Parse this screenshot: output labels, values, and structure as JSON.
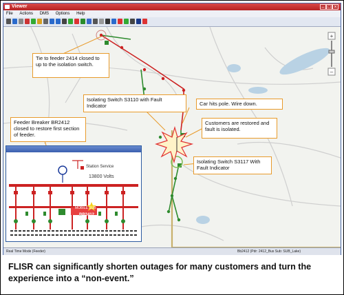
{
  "window": {
    "title": "Viewer"
  },
  "menu": {
    "items": [
      "File",
      "Actions",
      "DMS",
      "Options",
      "Help"
    ]
  },
  "callouts": {
    "tie_feeder": "Tie to feeder 2414 closed to up to the isolation switch.",
    "switch_s3110": "Isolating Switch S3110 with Fault Indicator",
    "car_hits_pole": "Car hits pole. Wire down.",
    "customers_restored": "Customers are restored and fault is isolated.",
    "breaker_br2412": "Feeder Breaker BR2412 closed to restore first section of feeder.",
    "switch_s3117": "Isolating Switch S3117 With Fault Indicator"
  },
  "inset": {
    "station_service": "Station Service",
    "voltage": "13800 Volts",
    "mobile_sub": "MOBILE SUB",
    "breaker_label": "BR2412"
  },
  "status": {
    "mode": "Real Time Mode (Feeder)",
    "location": "Bb2412 (Pdr: 2412_Bus Sub: SUB_Lake)"
  },
  "caption": "FLISR can significantly shorten outages for many customers and turn the experience into a “non-event.”",
  "colors": {
    "accent_orange": "#e89a2a",
    "feeder_green": "#2e8b2e",
    "feeder_red": "#cc2222",
    "title_red": "#c03030"
  }
}
